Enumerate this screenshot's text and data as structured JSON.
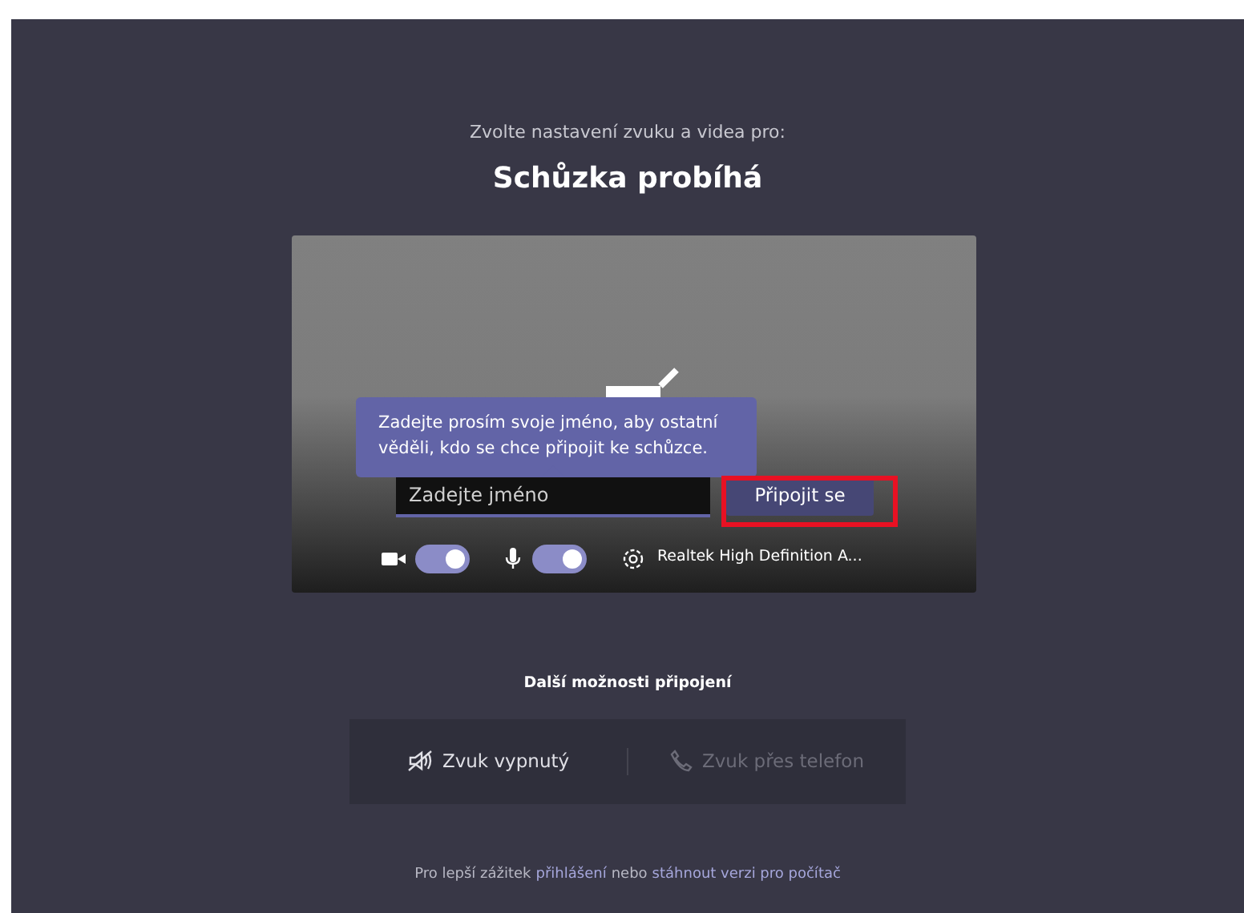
{
  "header": {
    "subtitle": "Zvolte nastavení zvuku a videa pro:",
    "title": "Schůzka probíhá"
  },
  "preview": {
    "tooltip": "Zadejte prosím svoje jméno, aby ostatní věděli, kdo se chce připojit ke schůzce.",
    "name_field": {
      "placeholder": "Zadejte jméno"
    },
    "join_button": "Připojit se",
    "highlighted": true,
    "camera": {
      "on": true
    },
    "microphone": {
      "on": true
    },
    "audio_device": "Realtek High Definition A..."
  },
  "more_options": {
    "title": "Další možnosti připojení",
    "options": [
      {
        "kind": "audio-off",
        "label": "Zvuk vypnutý",
        "disabled": false
      },
      {
        "kind": "phone",
        "label": "Zvuk přes telefon",
        "disabled": true
      }
    ]
  },
  "footer": [
    {
      "kind": "plain",
      "text": "Pro lepší zážitek"
    },
    {
      "kind": "link",
      "text": "přihlášení"
    },
    {
      "kind": "plain",
      "text": "nebo"
    },
    {
      "kind": "link",
      "text": "stáhnout verzi pro počítač"
    }
  ]
}
